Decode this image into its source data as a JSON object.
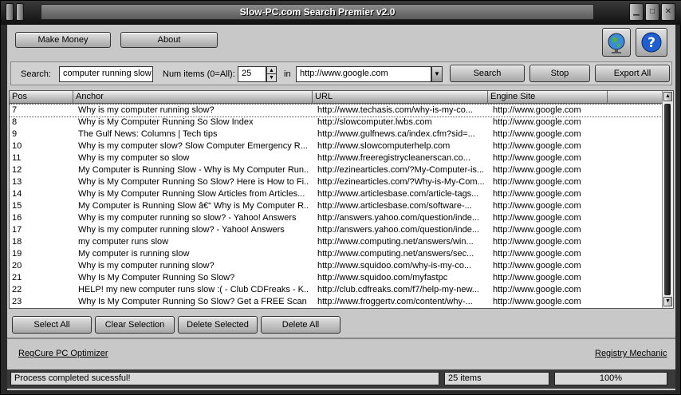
{
  "window": {
    "title": "Slow-PC.com Search Premier v2.0"
  },
  "toolbar": {
    "make_money": "Make Money",
    "about": "About"
  },
  "search": {
    "search_label": "Search:",
    "query": "computer running slow",
    "num_items_label": "Num items (0=All):",
    "num_items": "25",
    "in_label": "in",
    "engine": "http://www.google.com",
    "search_btn": "Search",
    "stop_btn": "Stop",
    "export_btn": "Export All"
  },
  "table": {
    "columns": [
      "Pos",
      "Anchor",
      "URL",
      "Engine Site"
    ],
    "rows": [
      [
        "7",
        "Why is my computer running slow?",
        "http://www.techasis.com/why-is-my-co...",
        "http://www.google.com"
      ],
      [
        "8",
        "Why is My Computer Running So Slow Index",
        "http://slowcomputer.lwbs.com",
        "http://www.google.com"
      ],
      [
        "9",
        "The Gulf News: Columns | Tech tips",
        "http://www.gulfnews.ca/index.cfm?sid=...",
        "http://www.google.com"
      ],
      [
        "10",
        "Why is my computer slow? Slow Computer Emergency R...",
        "http://www.slowcomputerhelp.com",
        "http://www.google.com"
      ],
      [
        "11",
        "Why is my computer so slow",
        "http://www.freeregistrycleanerscan.co...",
        "http://www.google.com"
      ],
      [
        "12",
        "My Computer is Running Slow - Why is My Computer Run...",
        "http://ezinearticles.com/?My-Computer-is...",
        "http://www.google.com"
      ],
      [
        "13",
        "Why is My Computer Running So Slow? Here is How to Fi...",
        "http://ezinearticles.com/?Why-is-My-Com...",
        "http://www.google.com"
      ],
      [
        "14",
        "Why is My Computer Running Slow Articles from Articles...",
        "http://www.articlesbase.com/article-tags...",
        "http://www.google.com"
      ],
      [
        "15",
        "My Computer is Running Slow â€“ Why is My Computer R...",
        "http://www.articlesbase.com/software-...",
        "http://www.google.com"
      ],
      [
        "16",
        "Why is my computer running so slow? - Yahoo! Answers",
        "http://answers.yahoo.com/question/inde...",
        "http://www.google.com"
      ],
      [
        "17",
        "Why is my computer running slow? - Yahoo! Answers",
        "http://answers.yahoo.com/question/inde...",
        "http://www.google.com"
      ],
      [
        "18",
        "my computer runs slow",
        "http://www.computing.net/answers/win...",
        "http://www.google.com"
      ],
      [
        "19",
        "My computer is running slow",
        "http://www.computing.net/answers/sec...",
        "http://www.google.com"
      ],
      [
        "20",
        "Why is my computer running slow?",
        "http://www.squidoo.com/why-is-my-co...",
        "http://www.google.com"
      ],
      [
        "21",
        "Why Is My Computer Running So Slow?",
        "http://www.squidoo.com/myfastpc",
        "http://www.google.com"
      ],
      [
        "22",
        "HELP! my new computer runs slow :( - Club CDFreaks - K...",
        "http://club.cdfreaks.com/f7/help-my-new...",
        "http://www.google.com"
      ],
      [
        "23",
        "Why Is My Computer Running So Slow? Get a FREE Scan ...",
        "http://www.froggertv.com/content/why-...",
        "http://www.google.com"
      ]
    ]
  },
  "actions": {
    "select_all": "Select All",
    "clear_selection": "Clear Selection",
    "delete_selected": "Delete Selected",
    "delete_all": "Delete All"
  },
  "links": {
    "left": "RegCure PC Optimizer",
    "right": "Registry Mechanic"
  },
  "status": {
    "message": "Process completed sucessful!",
    "count": "25 items",
    "progress": "100%"
  }
}
